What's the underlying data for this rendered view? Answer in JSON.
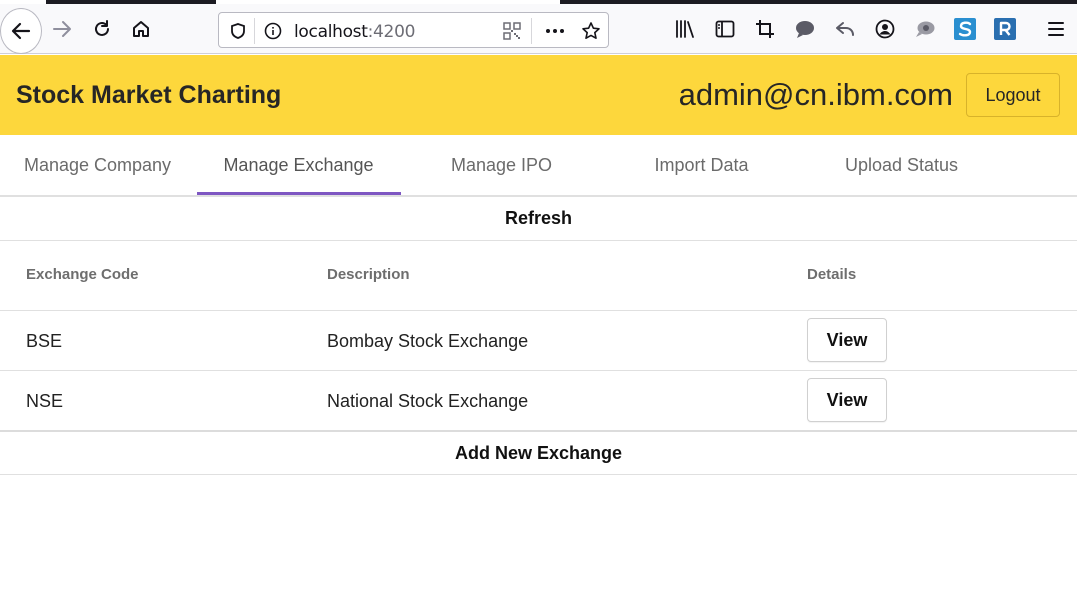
{
  "browser": {
    "url_host": "localhost",
    "url_port": ":4200"
  },
  "header": {
    "title": "Stock Market Charting",
    "user_email": "admin@cn.ibm.com",
    "logout_label": "Logout",
    "background_color": "#fdd73c"
  },
  "tabs": [
    {
      "label": "Manage Company"
    },
    {
      "label": "Manage Exchange",
      "active": true
    },
    {
      "label": "Manage IPO"
    },
    {
      "label": "Import Data"
    },
    {
      "label": "Upload Status"
    }
  ],
  "tab_accent_color": "#7e57c2",
  "refresh_label": "Refresh",
  "table": {
    "columns": [
      "Exchange Code",
      "Description",
      "Details"
    ],
    "rows": [
      {
        "code": "BSE",
        "description": "Bombay Stock Exchange",
        "action": "View"
      },
      {
        "code": "NSE",
        "description": "National Stock Exchange",
        "action": "View"
      }
    ]
  },
  "add_label": "Add New Exchange"
}
